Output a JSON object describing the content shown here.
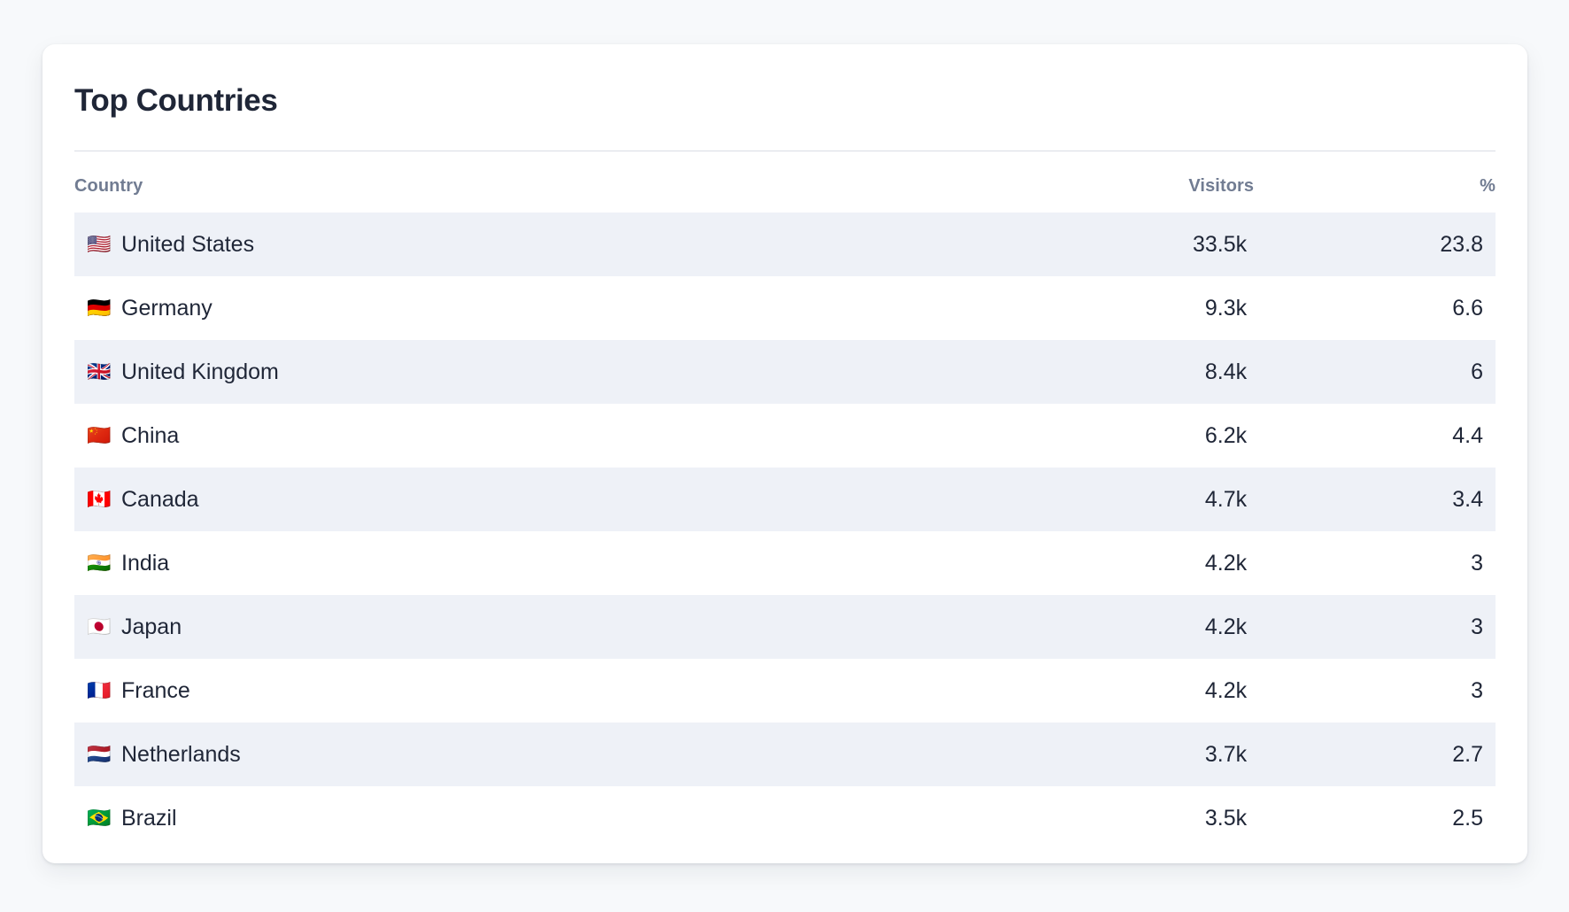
{
  "card": {
    "title": "Top Countries"
  },
  "table": {
    "columns": {
      "country": "Country",
      "visitors": "Visitors",
      "percent": "%"
    },
    "rows": [
      {
        "flag": "🇺🇸",
        "flag_name": "flag-united-states",
        "country": "United States",
        "visitors": "33.5k",
        "percent": "23.8"
      },
      {
        "flag": "🇩🇪",
        "flag_name": "flag-germany",
        "country": "Germany",
        "visitors": "9.3k",
        "percent": "6.6"
      },
      {
        "flag": "🇬🇧",
        "flag_name": "flag-united-kingdom",
        "country": "United Kingdom",
        "visitors": "8.4k",
        "percent": "6"
      },
      {
        "flag": "🇨🇳",
        "flag_name": "flag-china",
        "country": "China",
        "visitors": "6.2k",
        "percent": "4.4"
      },
      {
        "flag": "🇨🇦",
        "flag_name": "flag-canada",
        "country": "Canada",
        "visitors": "4.7k",
        "percent": "3.4"
      },
      {
        "flag": "🇮🇳",
        "flag_name": "flag-india",
        "country": "India",
        "visitors": "4.2k",
        "percent": "3"
      },
      {
        "flag": "🇯🇵",
        "flag_name": "flag-japan",
        "country": "Japan",
        "visitors": "4.2k",
        "percent": "3"
      },
      {
        "flag": "🇫🇷",
        "flag_name": "flag-france",
        "country": "France",
        "visitors": "4.2k",
        "percent": "3"
      },
      {
        "flag": "🇳🇱",
        "flag_name": "flag-netherlands",
        "country": "Netherlands",
        "visitors": "3.7k",
        "percent": "2.7"
      },
      {
        "flag": "🇧🇷",
        "flag_name": "flag-brazil",
        "country": "Brazil",
        "visitors": "3.5k",
        "percent": "2.5"
      }
    ]
  },
  "colors": {
    "page_background": "#f7f9fb",
    "card_background": "#ffffff",
    "row_striped": "#eef1f7",
    "title": "#1f2637",
    "header_text": "#717c92",
    "divider": "#d9dde5"
  }
}
